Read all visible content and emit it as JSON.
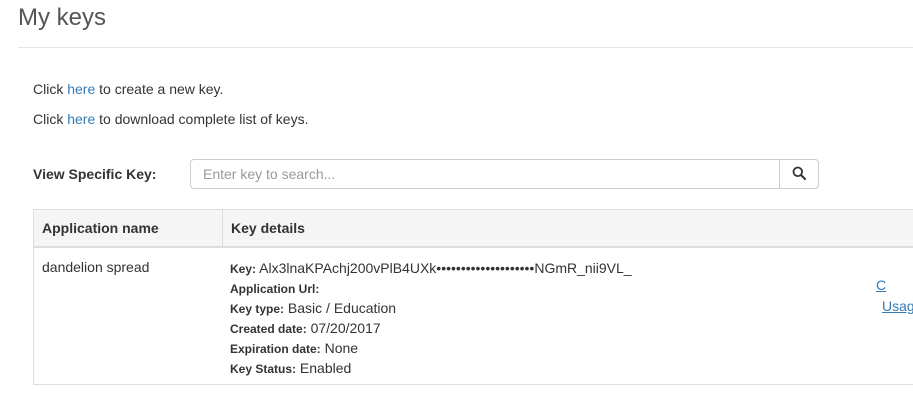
{
  "header": {
    "title": "My keys"
  },
  "actions": {
    "create": {
      "prefix": "Click ",
      "link": "here",
      "suffix": " to create a new key."
    },
    "download": {
      "prefix": "Click ",
      "link": "here",
      "suffix": " to download complete list of keys."
    }
  },
  "search": {
    "label": "View Specific Key:",
    "placeholder": "Enter key to search...",
    "icon": "search-icon"
  },
  "table": {
    "columns": [
      "Application name",
      "Key details"
    ],
    "rows": [
      {
        "app_name": "dandelion spread",
        "key_label": "Key:",
        "key_value": "Alx3lnaKPAchj200vPlB4UXk••••••••••••••••••••NGmR_nii9VL_",
        "url_label": "Application Url:",
        "url_value": "",
        "type_label": "Key type:",
        "type_value": "Basic / Education",
        "created_label": "Created date:",
        "created_value": "07/20/2017",
        "expiration_label": "Expiration date:",
        "expiration_value": "None",
        "status_label": "Key Status:",
        "status_value": "Enabled",
        "edge_link_top": "C",
        "edge_link_usage": "Usag"
      }
    ]
  }
}
